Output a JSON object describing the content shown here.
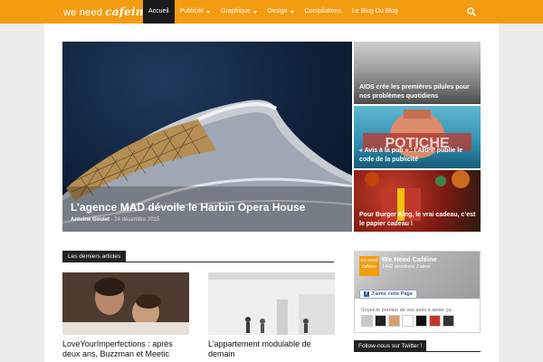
{
  "site": {
    "logo_light": "we need",
    "logo_strong": "cafeine"
  },
  "nav": {
    "items": [
      {
        "label": "Accueil",
        "active": true,
        "dropdown": false
      },
      {
        "label": "Publicité",
        "active": false,
        "dropdown": true
      },
      {
        "label": "Graphique",
        "active": false,
        "dropdown": true
      },
      {
        "label": "Design",
        "active": false,
        "dropdown": true
      },
      {
        "label": "Compilations",
        "active": false,
        "dropdown": false
      },
      {
        "label": "Le Blog Du Blog",
        "active": false,
        "dropdown": false
      }
    ],
    "search_icon": "search-icon"
  },
  "hero": {
    "title": "L’agence MAD dévoile le Harbin Opera House",
    "author": "Antoine Goulet",
    "separator": "-",
    "date": "24 décembre 2015"
  },
  "tiles": [
    {
      "title": "AIDS crée les premières pilules pour nos problèmes quotidiens"
    },
    {
      "title": "« Avis à la pub » : l’ARPP publie le code de la publicité"
    },
    {
      "title": "Pour Burger King, le vrai cadeau, c’est le papier cadeau !"
    }
  ],
  "latest": {
    "header": "Les derniers articles",
    "cards": [
      {
        "title": "LoveYourImperfections : après deux ans, Buzzman et Meetic"
      },
      {
        "title": "L’appartement modulable de demain"
      }
    ]
  },
  "facebook": {
    "logo_text": "we need cafeine",
    "page_name": "We Need Caféine",
    "count": "1442 mentions J’aime",
    "like_label": "J'aime cette Page",
    "friends_text": "Soyez le premier de vos amis à aimer ça.",
    "avatar_colors": [
      "#c9c9c9",
      "#222222",
      "#d8a070",
      "#ffffff",
      "#111111",
      "#c0392b",
      "#333333"
    ]
  },
  "twitter": {
    "header": "Follow-nous sur Twitter !"
  },
  "colors": {
    "brand": "#f39c12",
    "dark": "#1a1a1a"
  }
}
